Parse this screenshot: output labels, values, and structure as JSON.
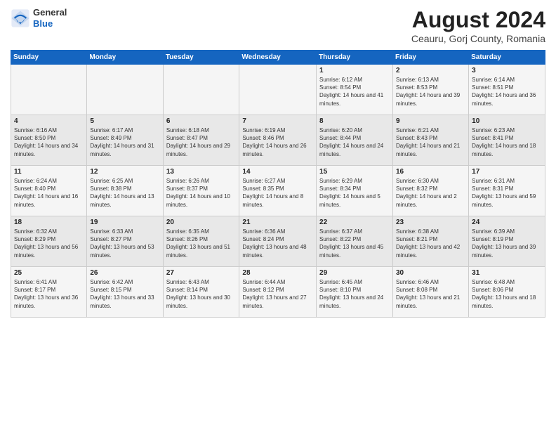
{
  "logo": {
    "general": "General",
    "blue": "Blue"
  },
  "title": "August 2024",
  "subtitle": "Ceauru, Gorj County, Romania",
  "days_of_week": [
    "Sunday",
    "Monday",
    "Tuesday",
    "Wednesday",
    "Thursday",
    "Friday",
    "Saturday"
  ],
  "weeks": [
    [
      {
        "day": "",
        "info": ""
      },
      {
        "day": "",
        "info": ""
      },
      {
        "day": "",
        "info": ""
      },
      {
        "day": "",
        "info": ""
      },
      {
        "day": "1",
        "info": "Sunrise: 6:12 AM\nSunset: 8:54 PM\nDaylight: 14 hours and 41 minutes."
      },
      {
        "day": "2",
        "info": "Sunrise: 6:13 AM\nSunset: 8:53 PM\nDaylight: 14 hours and 39 minutes."
      },
      {
        "day": "3",
        "info": "Sunrise: 6:14 AM\nSunset: 8:51 PM\nDaylight: 14 hours and 36 minutes."
      }
    ],
    [
      {
        "day": "4",
        "info": "Sunrise: 6:16 AM\nSunset: 8:50 PM\nDaylight: 14 hours and 34 minutes."
      },
      {
        "day": "5",
        "info": "Sunrise: 6:17 AM\nSunset: 8:49 PM\nDaylight: 14 hours and 31 minutes."
      },
      {
        "day": "6",
        "info": "Sunrise: 6:18 AM\nSunset: 8:47 PM\nDaylight: 14 hours and 29 minutes."
      },
      {
        "day": "7",
        "info": "Sunrise: 6:19 AM\nSunset: 8:46 PM\nDaylight: 14 hours and 26 minutes."
      },
      {
        "day": "8",
        "info": "Sunrise: 6:20 AM\nSunset: 8:44 PM\nDaylight: 14 hours and 24 minutes."
      },
      {
        "day": "9",
        "info": "Sunrise: 6:21 AM\nSunset: 8:43 PM\nDaylight: 14 hours and 21 minutes."
      },
      {
        "day": "10",
        "info": "Sunrise: 6:23 AM\nSunset: 8:41 PM\nDaylight: 14 hours and 18 minutes."
      }
    ],
    [
      {
        "day": "11",
        "info": "Sunrise: 6:24 AM\nSunset: 8:40 PM\nDaylight: 14 hours and 16 minutes."
      },
      {
        "day": "12",
        "info": "Sunrise: 6:25 AM\nSunset: 8:38 PM\nDaylight: 14 hours and 13 minutes."
      },
      {
        "day": "13",
        "info": "Sunrise: 6:26 AM\nSunset: 8:37 PM\nDaylight: 14 hours and 10 minutes."
      },
      {
        "day": "14",
        "info": "Sunrise: 6:27 AM\nSunset: 8:35 PM\nDaylight: 14 hours and 8 minutes."
      },
      {
        "day": "15",
        "info": "Sunrise: 6:29 AM\nSunset: 8:34 PM\nDaylight: 14 hours and 5 minutes."
      },
      {
        "day": "16",
        "info": "Sunrise: 6:30 AM\nSunset: 8:32 PM\nDaylight: 14 hours and 2 minutes."
      },
      {
        "day": "17",
        "info": "Sunrise: 6:31 AM\nSunset: 8:31 PM\nDaylight: 13 hours and 59 minutes."
      }
    ],
    [
      {
        "day": "18",
        "info": "Sunrise: 6:32 AM\nSunset: 8:29 PM\nDaylight: 13 hours and 56 minutes."
      },
      {
        "day": "19",
        "info": "Sunrise: 6:33 AM\nSunset: 8:27 PM\nDaylight: 13 hours and 53 minutes."
      },
      {
        "day": "20",
        "info": "Sunrise: 6:35 AM\nSunset: 8:26 PM\nDaylight: 13 hours and 51 minutes."
      },
      {
        "day": "21",
        "info": "Sunrise: 6:36 AM\nSunset: 8:24 PM\nDaylight: 13 hours and 48 minutes."
      },
      {
        "day": "22",
        "info": "Sunrise: 6:37 AM\nSunset: 8:22 PM\nDaylight: 13 hours and 45 minutes."
      },
      {
        "day": "23",
        "info": "Sunrise: 6:38 AM\nSunset: 8:21 PM\nDaylight: 13 hours and 42 minutes."
      },
      {
        "day": "24",
        "info": "Sunrise: 6:39 AM\nSunset: 8:19 PM\nDaylight: 13 hours and 39 minutes."
      }
    ],
    [
      {
        "day": "25",
        "info": "Sunrise: 6:41 AM\nSunset: 8:17 PM\nDaylight: 13 hours and 36 minutes."
      },
      {
        "day": "26",
        "info": "Sunrise: 6:42 AM\nSunset: 8:15 PM\nDaylight: 13 hours and 33 minutes."
      },
      {
        "day": "27",
        "info": "Sunrise: 6:43 AM\nSunset: 8:14 PM\nDaylight: 13 hours and 30 minutes."
      },
      {
        "day": "28",
        "info": "Sunrise: 6:44 AM\nSunset: 8:12 PM\nDaylight: 13 hours and 27 minutes."
      },
      {
        "day": "29",
        "info": "Sunrise: 6:45 AM\nSunset: 8:10 PM\nDaylight: 13 hours and 24 minutes."
      },
      {
        "day": "30",
        "info": "Sunrise: 6:46 AM\nSunset: 8:08 PM\nDaylight: 13 hours and 21 minutes."
      },
      {
        "day": "31",
        "info": "Sunrise: 6:48 AM\nSunset: 8:06 PM\nDaylight: 13 hours and 18 minutes."
      }
    ]
  ]
}
